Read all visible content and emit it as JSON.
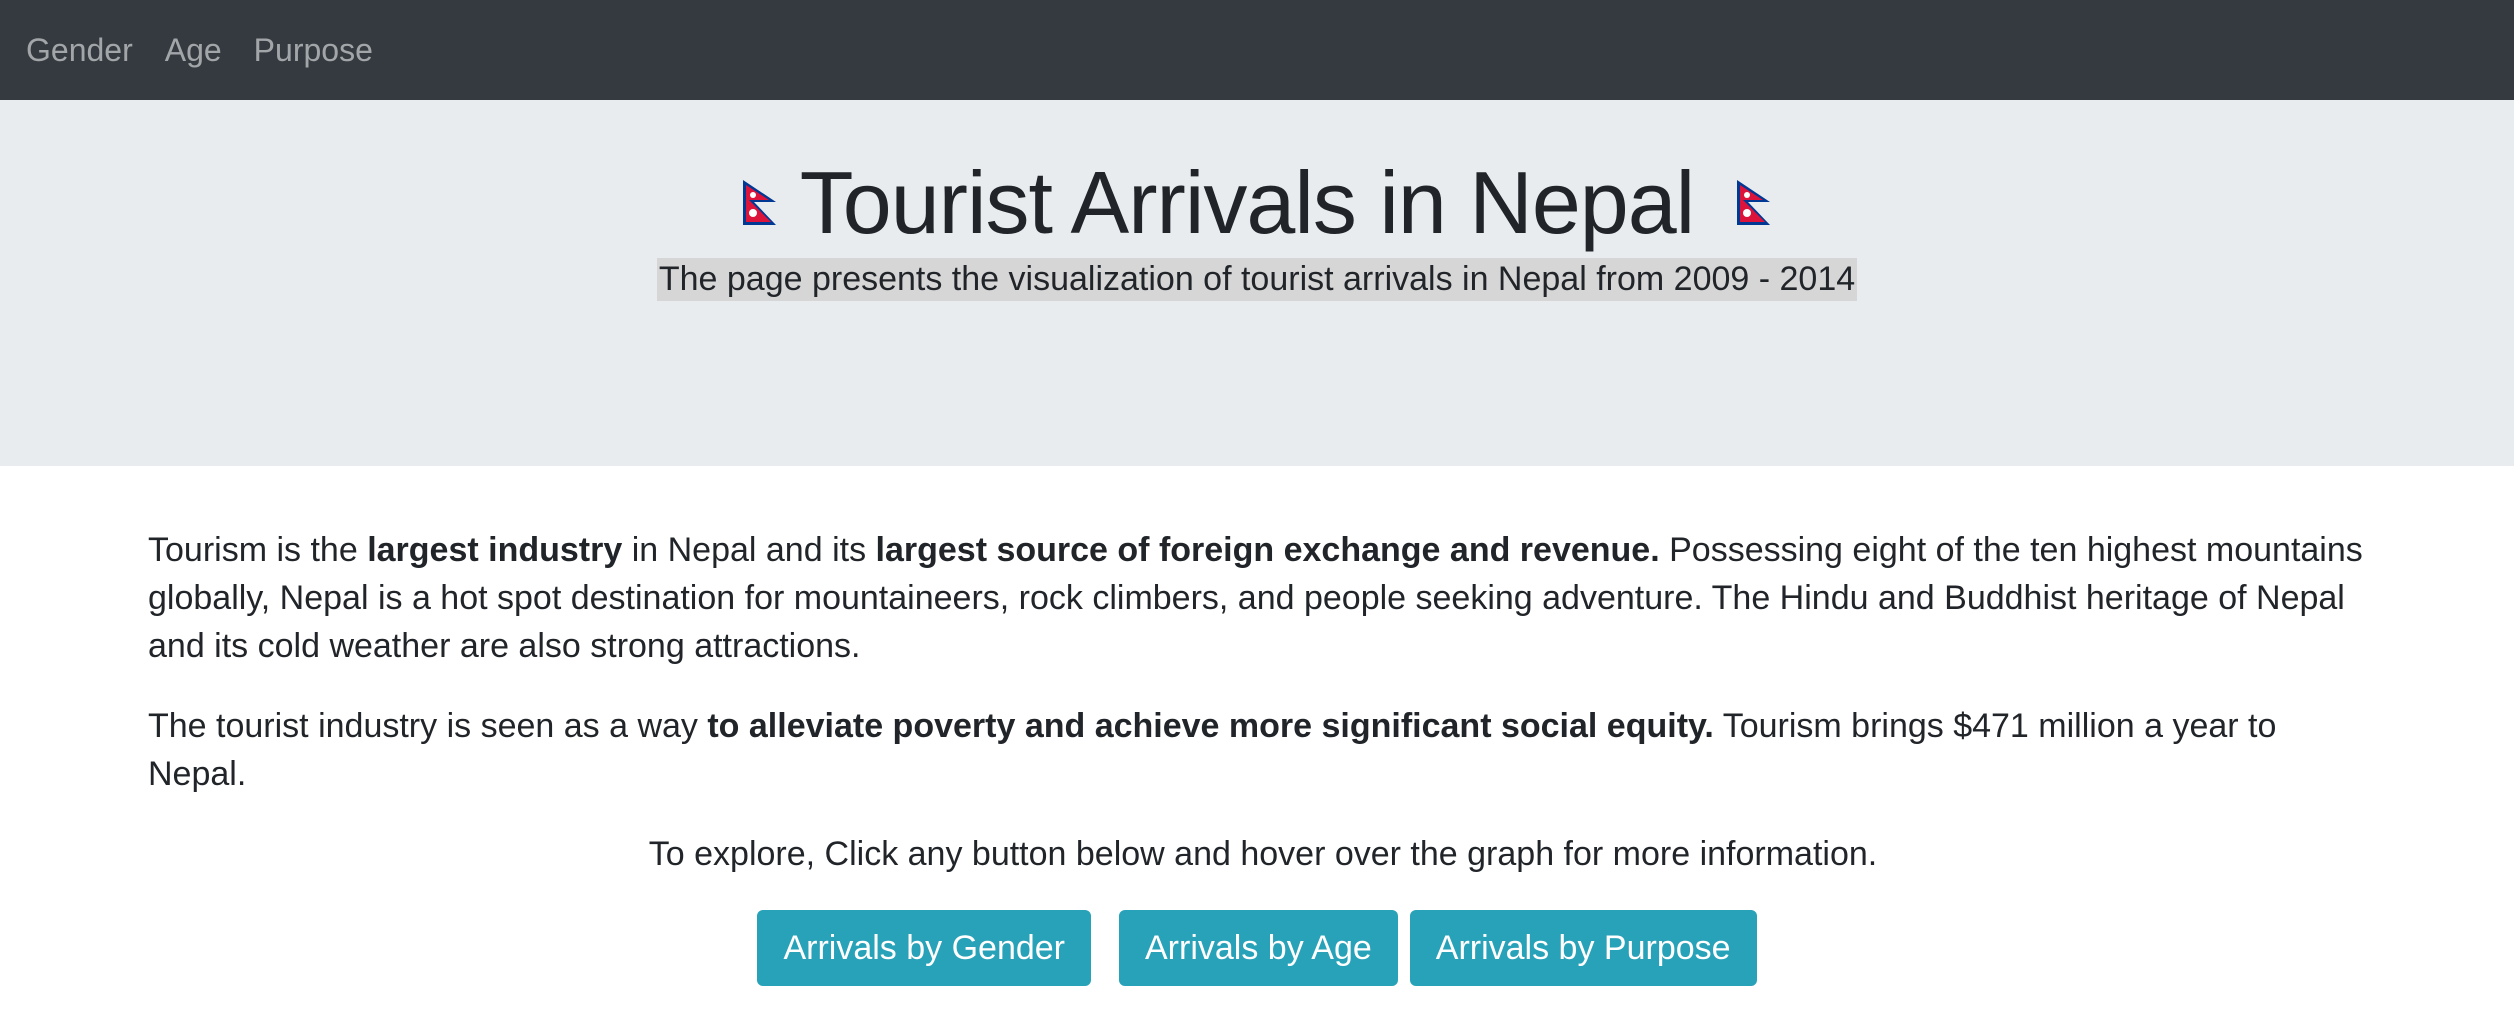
{
  "navbar": {
    "items": [
      {
        "label": "Gender"
      },
      {
        "label": "Age"
      },
      {
        "label": "Purpose"
      }
    ]
  },
  "header": {
    "title": "Tourist Arrivals in Nepal",
    "subtitle": "The page presents the visualization of tourist arrivals in Nepal from 2009 - 2014",
    "flag_icon": "nepal-flag-icon",
    "colors": {
      "flag_red": "#dc143c",
      "flag_blue": "#003893"
    }
  },
  "intro": {
    "p1_part1": "Tourism is the ",
    "p1_bold1": "largest industry",
    "p1_part2": " in Nepal and its ",
    "p1_bold2": "largest source of foreign exchange and revenue.",
    "p1_part3": " Possessing eight of the ten highest mountains globally, Nepal is a hot spot destination for mountaineers, rock climbers, and people seeking adventure. The Hindu and Buddhist heritage of Nepal and its cold weather are also strong attractions.",
    "p2_part1": "The tourist industry is seen as a way ",
    "p2_bold1": "to alleviate poverty and achieve more significant social equity.",
    "p2_part2": " Tourism brings $471 million a year to Nepal.",
    "explore": "To explore, Click any button below and hover over the graph for more information."
  },
  "buttons": {
    "gender": "Arrivals by Gender",
    "age": "Arrivals by Age",
    "purpose": "Arrivals by Purpose"
  },
  "colors": {
    "navbar_bg": "#343a40",
    "jumbotron_bg": "#e9ecef",
    "button_bg": "#28a2b8"
  }
}
